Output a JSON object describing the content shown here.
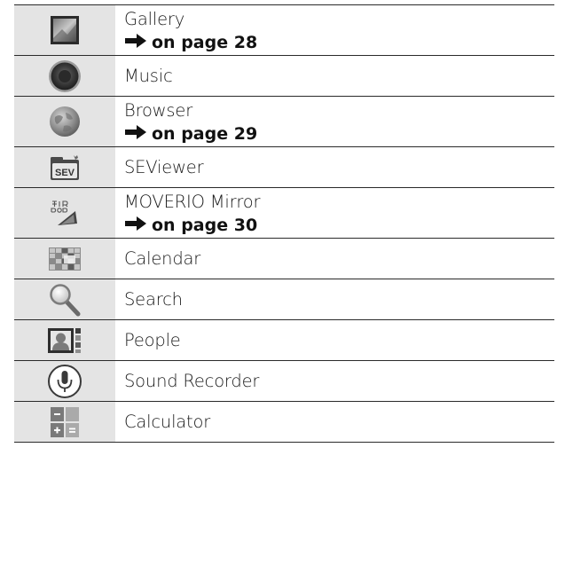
{
  "apps": [
    {
      "name": "Gallery",
      "page_ref": "on page 28",
      "icon": "gallery-icon"
    },
    {
      "name": "Music",
      "page_ref": "",
      "icon": "music-icon"
    },
    {
      "name": "Browser",
      "page_ref": "on page 29",
      "icon": "browser-icon"
    },
    {
      "name": "SEViewer",
      "page_ref": "",
      "icon": "seviewer-icon",
      "icon_text": "SEV"
    },
    {
      "name": "MOVERIO Mirror",
      "page_ref": "on page 30",
      "icon": "moverio-mirror-icon"
    },
    {
      "name": "Calendar",
      "page_ref": "",
      "icon": "calendar-icon"
    },
    {
      "name": "Search",
      "page_ref": "",
      "icon": "search-icon"
    },
    {
      "name": "People",
      "page_ref": "",
      "icon": "people-icon"
    },
    {
      "name": "Sound Recorder",
      "page_ref": "",
      "icon": "microphone-icon"
    },
    {
      "name": "Calculator",
      "page_ref": "",
      "icon": "calculator-icon"
    }
  ],
  "colors": {
    "icon_cell_bg": "#e4e4e4",
    "rule": "#2a2a2a",
    "text": "#1a1a1a"
  }
}
